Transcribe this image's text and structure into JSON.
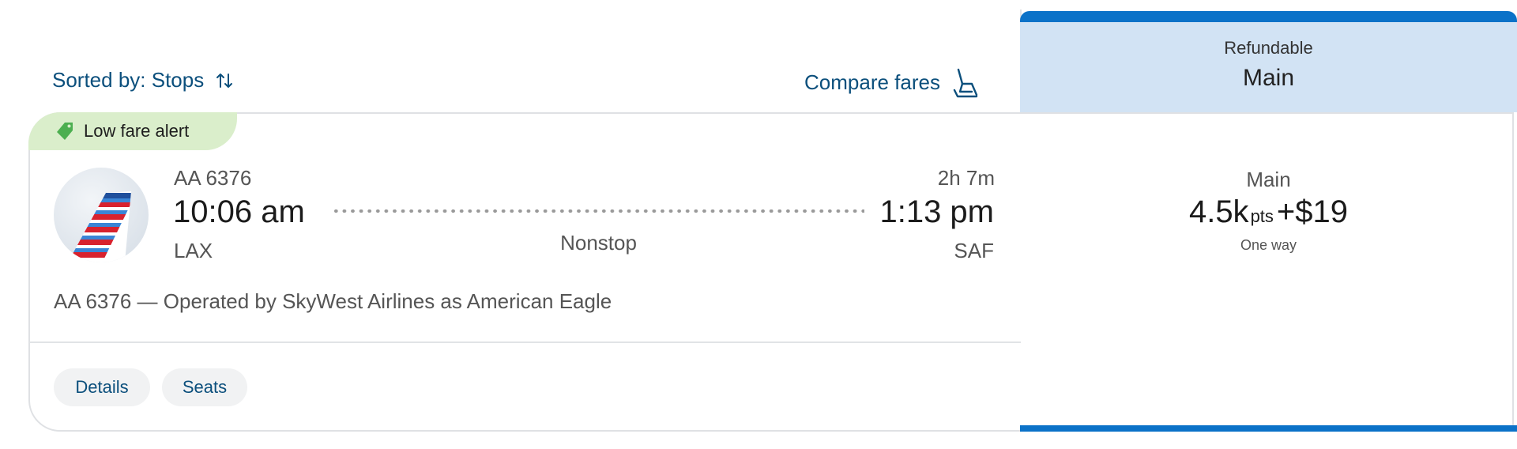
{
  "header": {
    "sort_label": "Sorted by: Stops",
    "compare_label": "Compare fares"
  },
  "alert": {
    "label": "Low fare alert",
    "color": "#daeecb"
  },
  "flight": {
    "flight_number": "AA 6376",
    "departure_time": "10:06 am",
    "departure_airport": "LAX",
    "arrival_time": "1:13 pm",
    "arrival_airport": "SAF",
    "duration": "2h 7m",
    "stops": "Nonstop",
    "operated_by": "AA 6376 — Operated by SkyWest Airlines as American Eagle",
    "airline_logo": "american-airlines-tail-icon"
  },
  "actions": {
    "details_label": "Details",
    "seats_label": "Seats"
  },
  "fare": {
    "refundable_label": "Refundable",
    "cabin_header": "Main",
    "cabin": "Main",
    "points": "4.5k",
    "points_unit": "pts",
    "plus": "+",
    "cash": "$19",
    "trip_type": "One way",
    "accent_color": "#0b72c8",
    "header_bg": "#d2e3f4"
  },
  "icons": {
    "sort": "sort-arrows-icon",
    "compare": "seat-icon",
    "alert": "price-tag-icon"
  }
}
